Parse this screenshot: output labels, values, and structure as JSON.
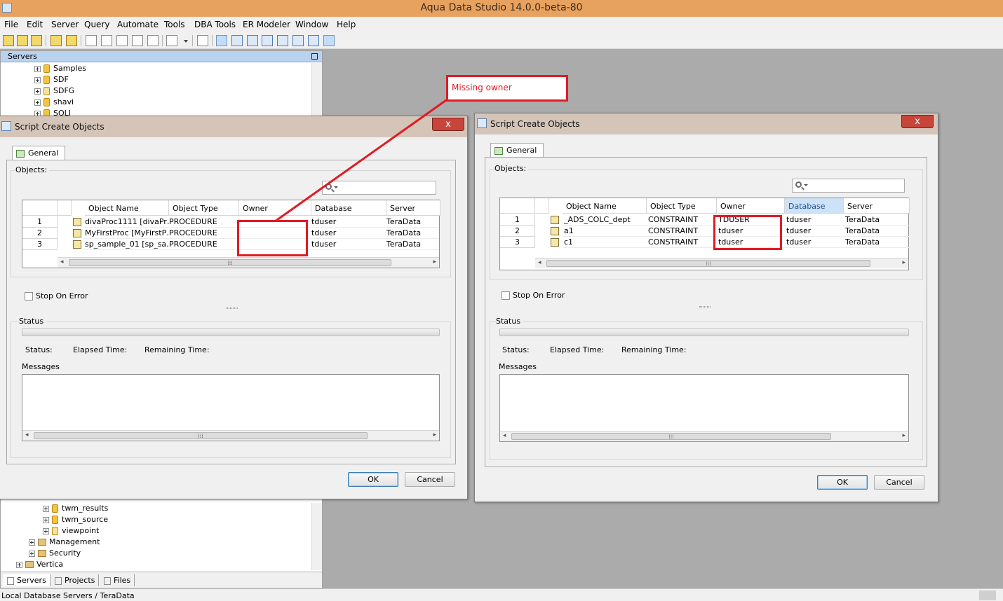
{
  "app": {
    "title": "Aqua Data Studio 14.0.0-beta-80"
  },
  "menu": [
    "File",
    "Edit",
    "Server",
    "Query",
    "Automate",
    "Tools",
    "DBA Tools",
    "ER Modeler",
    "Window",
    "Help"
  ],
  "servers_panel": {
    "title": "Servers",
    "top_items": [
      "Samples",
      "SDF",
      "SDFG",
      "shavi",
      "SQLJ"
    ],
    "bottom_items": [
      "twm_results",
      "twm_source",
      "viewpoint",
      "Management",
      "Security",
      "Vertica"
    ],
    "tabs": [
      "Servers",
      "Projects",
      "Files"
    ]
  },
  "status_bar": {
    "text": "Local Database Servers / TeraData"
  },
  "dialog_left": {
    "title": "Script Create Objects",
    "close": "x",
    "tab": "General",
    "objects_label": "Objects:",
    "search_placeholder": "",
    "columns": [
      "",
      "Object Name",
      "Object Type",
      "Owner",
      "Database",
      "Server"
    ],
    "rows": [
      {
        "num": "1",
        "name": "divaProc1111 [divaPr…",
        "type": "PROCEDURE",
        "owner": "",
        "database": "tduser",
        "server": "TeraData"
      },
      {
        "num": "2",
        "name": "MyFirstProc [MyFirstP…",
        "type": "PROCEDURE",
        "owner": "",
        "database": "tduser",
        "server": "TeraData"
      },
      {
        "num": "3",
        "name": "sp_sample_01 [sp_sa…",
        "type": "PROCEDURE",
        "owner": "",
        "database": "tduser",
        "server": "TeraData"
      }
    ],
    "stop_on_error": "Stop On Error",
    "status_label": "Status",
    "status_text": "Status:",
    "elapsed_text": "Elapsed Time:",
    "remaining_text": "Remaining Time:",
    "messages_label": "Messages",
    "ok": "OK",
    "cancel": "Cancel"
  },
  "dialog_right": {
    "title": "Script Create Objects",
    "close": "x",
    "tab": "General",
    "objects_label": "Objects:",
    "search_placeholder": "",
    "columns": [
      "",
      "Object Name",
      "Object Type",
      "Owner",
      "Database",
      "Server"
    ],
    "rows": [
      {
        "num": "1",
        "name": "_ADS_COLC_dept",
        "type": "CONSTRAINT",
        "owner": "TDUSER",
        "database": "tduser",
        "server": "TeraData"
      },
      {
        "num": "2",
        "name": "a1",
        "type": "CONSTRAINT",
        "owner": "tduser",
        "database": "tduser",
        "server": "TeraData"
      },
      {
        "num": "3",
        "name": "c1",
        "type": "CONSTRAINT",
        "owner": "tduser",
        "database": "tduser",
        "server": "TeraData"
      }
    ],
    "stop_on_error": "Stop On Error",
    "status_label": "Status",
    "status_text": "Status:",
    "elapsed_text": "Elapsed Time:",
    "remaining_text": "Remaining Time:",
    "messages_label": "Messages",
    "ok": "OK",
    "cancel": "Cancel"
  },
  "annotation": {
    "callout_text": "Missing owner",
    "color": "#e01b24"
  }
}
